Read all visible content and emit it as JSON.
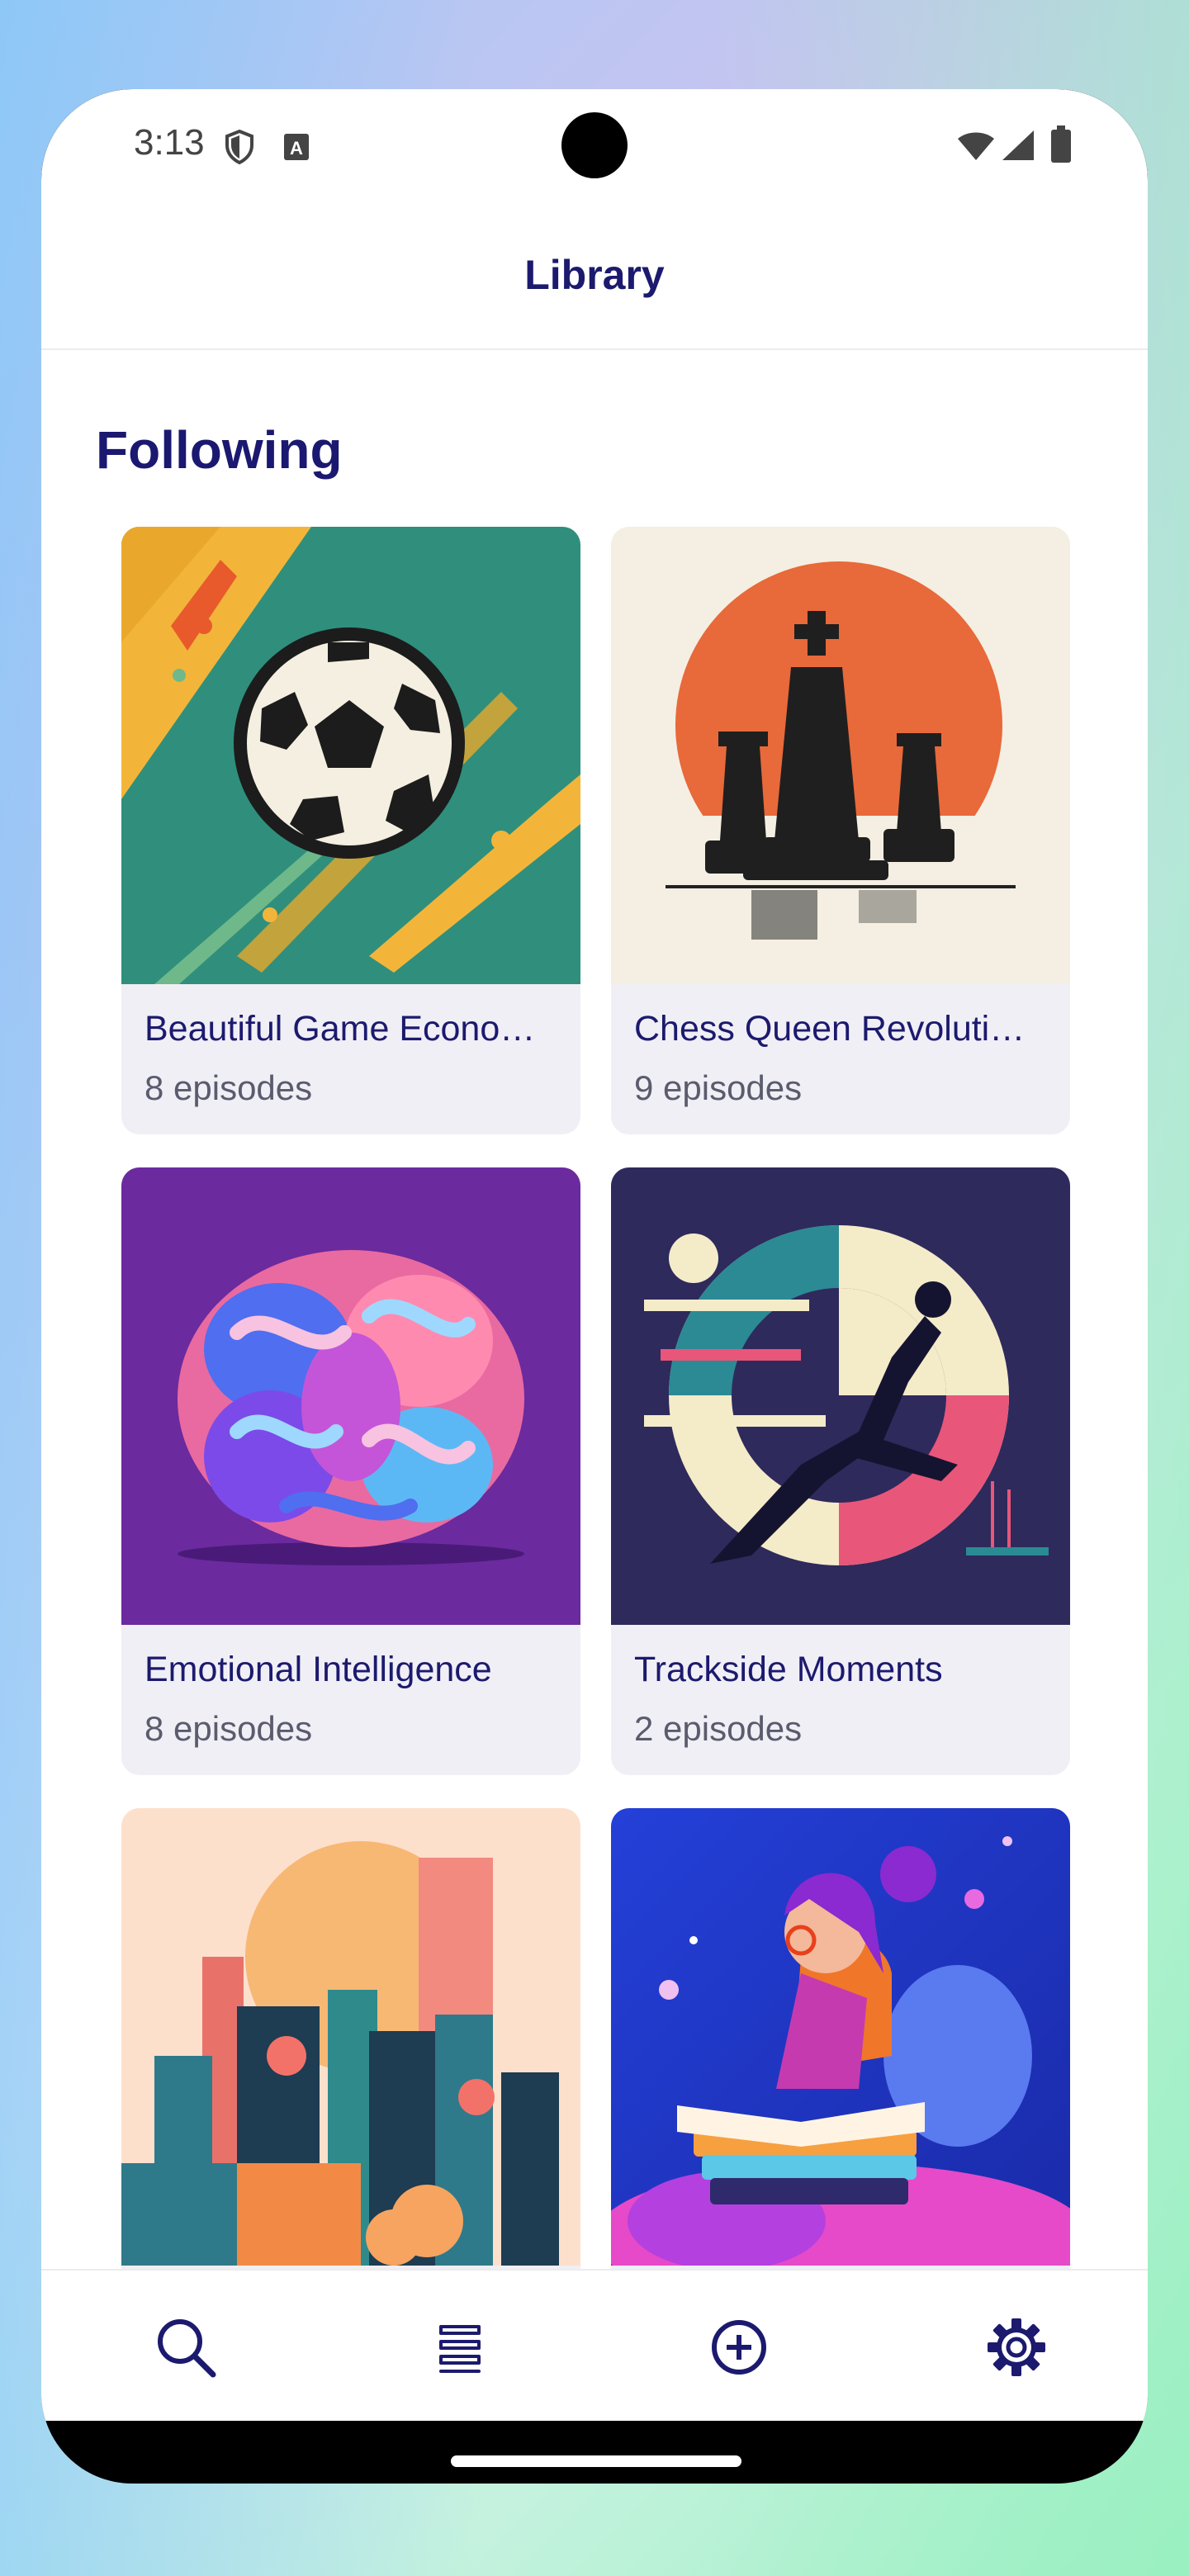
{
  "status": {
    "time": "3:13"
  },
  "appbar": {
    "title": "Library"
  },
  "section": {
    "title": "Following"
  },
  "cards": [
    {
      "title": "Beautiful Game Econo…",
      "subtitle": "8 episodes",
      "art": "soccer-ball-art"
    },
    {
      "title": "Chess Queen Revoluti…",
      "subtitle": "9 episodes",
      "art": "chess-pieces-art"
    },
    {
      "title": "Emotional Intelligence",
      "subtitle": "8 episodes",
      "art": "brain-art"
    },
    {
      "title": "Trackside Moments",
      "subtitle": "2 episodes",
      "art": "sprinter-art"
    },
    {
      "title": "",
      "subtitle": "",
      "art": "city-skyline-art"
    },
    {
      "title": "",
      "subtitle": "",
      "art": "reading-woman-art"
    }
  ],
  "nav": {
    "items": [
      {
        "icon": "search-icon"
      },
      {
        "icon": "library-icon"
      },
      {
        "icon": "add-circle-icon"
      },
      {
        "icon": "settings-icon"
      }
    ]
  },
  "colors": {
    "accent": "#1c1a6e",
    "card_bg": "#f0eff5"
  }
}
